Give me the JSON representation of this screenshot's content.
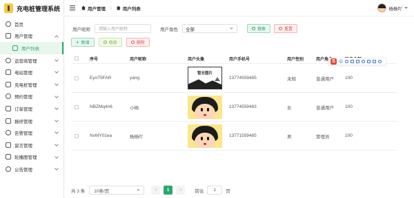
{
  "app": {
    "title": "充电桩管理系统"
  },
  "sidebar": {
    "items": [
      {
        "label": "首页",
        "icon": "home-icon",
        "expandable": false
      },
      {
        "label": "用户管理",
        "icon": "user-icon",
        "expandable": true,
        "expanded": true
      },
      {
        "label": "用户列表",
        "icon": "list-icon",
        "sub": true,
        "active": true
      },
      {
        "label": "运营商管理",
        "icon": "operator-icon",
        "expandable": true
      },
      {
        "label": "电站管理",
        "icon": "station-icon",
        "expandable": true
      },
      {
        "label": "充电桩管理",
        "icon": "charger-icon",
        "expandable": true
      },
      {
        "label": "预约管理",
        "icon": "reserve-icon",
        "expandable": true
      },
      {
        "label": "订单管理",
        "icon": "order-icon",
        "expandable": true
      },
      {
        "label": "报修管理",
        "icon": "repair-icon",
        "expandable": true
      },
      {
        "label": "告警管理",
        "icon": "alarm-icon",
        "expandable": true
      },
      {
        "label": "留言管理",
        "icon": "message-icon",
        "expandable": true
      },
      {
        "label": "轮播图管理",
        "icon": "carousel-icon",
        "expandable": true
      },
      {
        "label": "公告管理",
        "icon": "notice-icon",
        "expandable": true
      }
    ]
  },
  "header": {
    "breadcrumb": [
      "用户管理",
      "用户列表"
    ],
    "user_name": "杨杨吖"
  },
  "filters": {
    "nickname_label": "用户昵称",
    "nickname_placeholder": "请输入用户昵称",
    "role_label": "用户角色",
    "role_value": "全部",
    "search_label": "搜索",
    "reset_label": "重置"
  },
  "actions": {
    "add": "新增",
    "edit": "修改",
    "delete": "删除"
  },
  "table": {
    "headers": [
      "序号",
      "用户昵称",
      "用户头像",
      "用户手机号",
      "用户性别",
      "用户角色",
      "账户余额"
    ],
    "rows": [
      {
        "id": "EyoT5FAR",
        "nickname": "yang",
        "avatar": "placeholder",
        "avatar_text": "暂无图片",
        "phone": "13774559485",
        "gender": "未知",
        "role": "普通用户",
        "extra": "100"
      },
      {
        "id": "NBZMq4n6",
        "nickname": "小杨",
        "avatar": "chibi",
        "phone": "13774559483",
        "gender": "女",
        "role": "普通用户",
        "extra": "100"
      },
      {
        "id": "NvMY01ea",
        "nickname": "杨杨吖",
        "avatar": "chibi",
        "phone": "13771559485",
        "gender": "男",
        "role": "管理员",
        "extra": "100"
      }
    ]
  },
  "ime_toolbar": {
    "brand": "S",
    "lang": "中"
  },
  "pagination": {
    "total_text": "共 3 条",
    "page_size": "10条/页",
    "prev": "<",
    "current": "1",
    "next": ">",
    "goto_label": "前往",
    "goto_value": "1",
    "page_suffix": "页"
  },
  "colors": {
    "accent": "#2aa86a",
    "danger": "#e05858"
  }
}
